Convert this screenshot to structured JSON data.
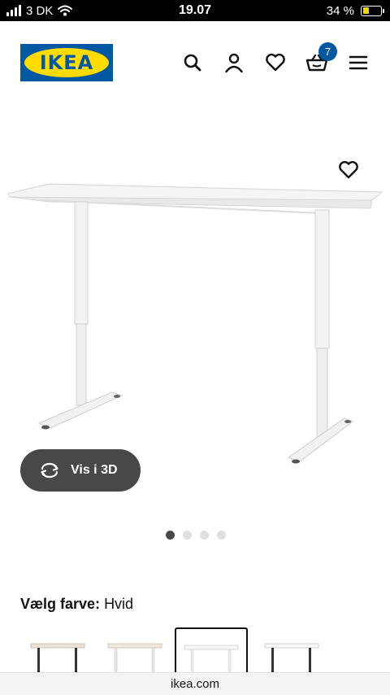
{
  "status_bar": {
    "carrier": "3 DK",
    "time": "19.07",
    "battery": "34 %",
    "battery_level": 0.34,
    "battery_color": "#f2d800"
  },
  "header": {
    "logo_text": "IKEA",
    "brand_blue": "#0058a3",
    "brand_yellow": "#ffdb00",
    "icons": [
      "search-icon",
      "account-icon",
      "heart-icon",
      "basket-icon",
      "menu-icon"
    ],
    "cart_count": "7"
  },
  "product": {
    "view_3d_label": "Vis i 3D",
    "carousel": {
      "total": 4,
      "active": 1
    }
  },
  "color_picker": {
    "label": "Vælg farve:",
    "selected_value": "Hvid"
  },
  "browser": {
    "url": "ikea.com"
  }
}
